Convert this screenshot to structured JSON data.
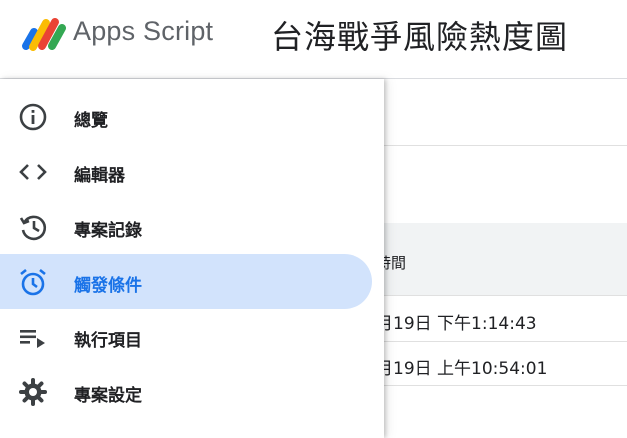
{
  "header": {
    "app_name": "Apps Script",
    "project_title": "台海戰爭風險熱度圖"
  },
  "sidebar": {
    "items": [
      {
        "label": "總覽",
        "icon": "info-icon",
        "active": false
      },
      {
        "label": "編輯器",
        "icon": "code-icon",
        "active": false
      },
      {
        "label": "專案記錄",
        "icon": "history-icon",
        "active": false
      },
      {
        "label": "觸發條件",
        "icon": "alarm-clock-icon",
        "active": true
      },
      {
        "label": "執行項目",
        "icon": "playlist-play-icon",
        "active": false
      },
      {
        "label": "專案設定",
        "icon": "gear-icon",
        "active": false
      }
    ]
  },
  "table": {
    "column_header": "時間",
    "rows": [
      {
        "time": "月19日 下午1:14:43"
      },
      {
        "time": "月19日 上午10:54:01"
      }
    ]
  },
  "colors": {
    "accent": "#1a73e8",
    "active_bg": "#d2e3fc",
    "icon_gray": "#5f6368"
  }
}
